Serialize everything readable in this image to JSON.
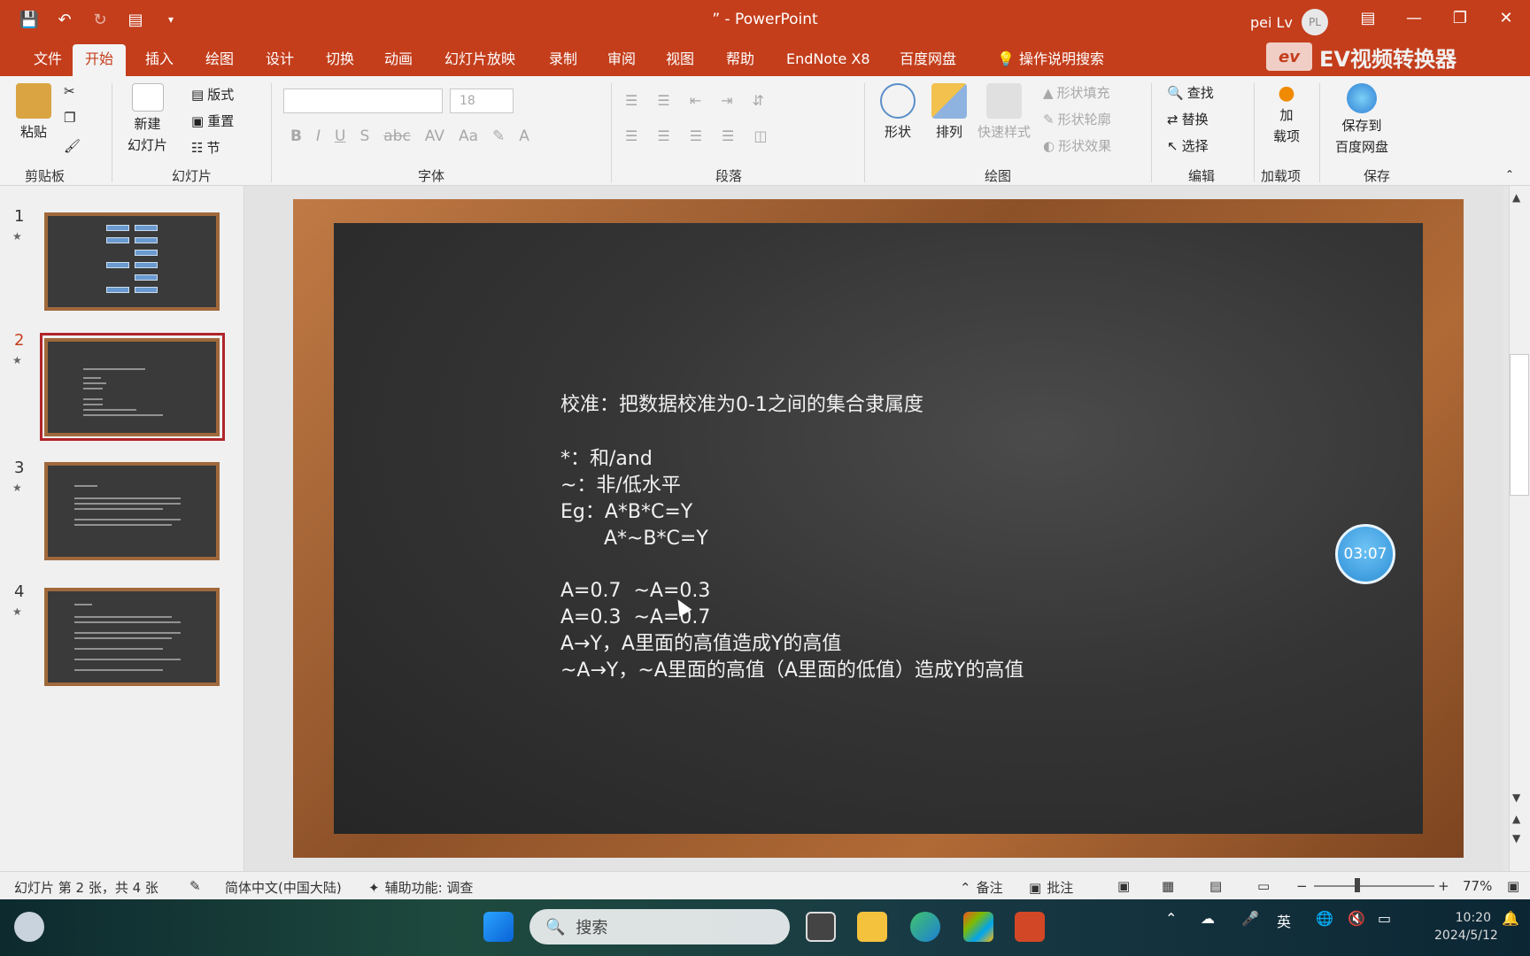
{
  "app": {
    "title": "” - PowerPoint",
    "user": "pei Lv",
    "avatar": "PL"
  },
  "menu": {
    "tabs": [
      "文件",
      "开始",
      "插入",
      "绘图",
      "设计",
      "切换",
      "动画",
      "幻灯片放映",
      "录制",
      "审阅",
      "视图",
      "帮助",
      "EndNote X8",
      "百度网盘"
    ],
    "search": "操作说明搜索",
    "ev_brand": "EV视频转换器",
    "ev_badge": "ev"
  },
  "ribbon": {
    "groups": [
      "剪贴板",
      "幻灯片",
      "字体",
      "段落",
      "绘图",
      "编辑",
      "加载项",
      "保存"
    ],
    "paste": "粘贴",
    "new_slide_1": "新建",
    "new_slide_2": "幻灯片",
    "layout": "版式",
    "reset": "重置",
    "section": "节",
    "font_size": "18",
    "shape": "形状",
    "arrange": "排列",
    "quick_style": "快速样式",
    "shape_fill": "形状填充",
    "shape_outline": "形状轮廓",
    "shape_effect": "形状效果",
    "find": "查找",
    "replace": "替换",
    "select": "选择",
    "addin_1": "加",
    "addin_2": "载项",
    "save_baidu_1": "保存到",
    "save_baidu_2": "百度网盘"
  },
  "slides": {
    "numbers": [
      "1",
      "2",
      "3",
      "4"
    ],
    "selected": 2
  },
  "slide": {
    "title_line": "校准：把数据校准为0-1之间的集合隶属度",
    "lines": [
      "*：和/and",
      "~：非/低水平",
      "Eg：A*B*C=Y",
      "       A*~B*C=Y",
      "A=0.7  ~A=0.3",
      "A=0.3  ~A=0.7",
      "A→Y，A里面的高值造成Y的高值",
      "~A→Y，~A里面的高值（A里面的低值）造成Y的高值"
    ],
    "timer": "03:07"
  },
  "status": {
    "slide_info": "幻灯片 第 2 张，共 4 张",
    "language": "简体中文(中国大陆)",
    "accessibility": "辅助功能: 调查",
    "notes": "备注",
    "comments": "批注",
    "zoom": "77%"
  },
  "taskbar": {
    "search": "搜索",
    "ime": "英",
    "time": "10:20",
    "date": "2024/5/12"
  }
}
